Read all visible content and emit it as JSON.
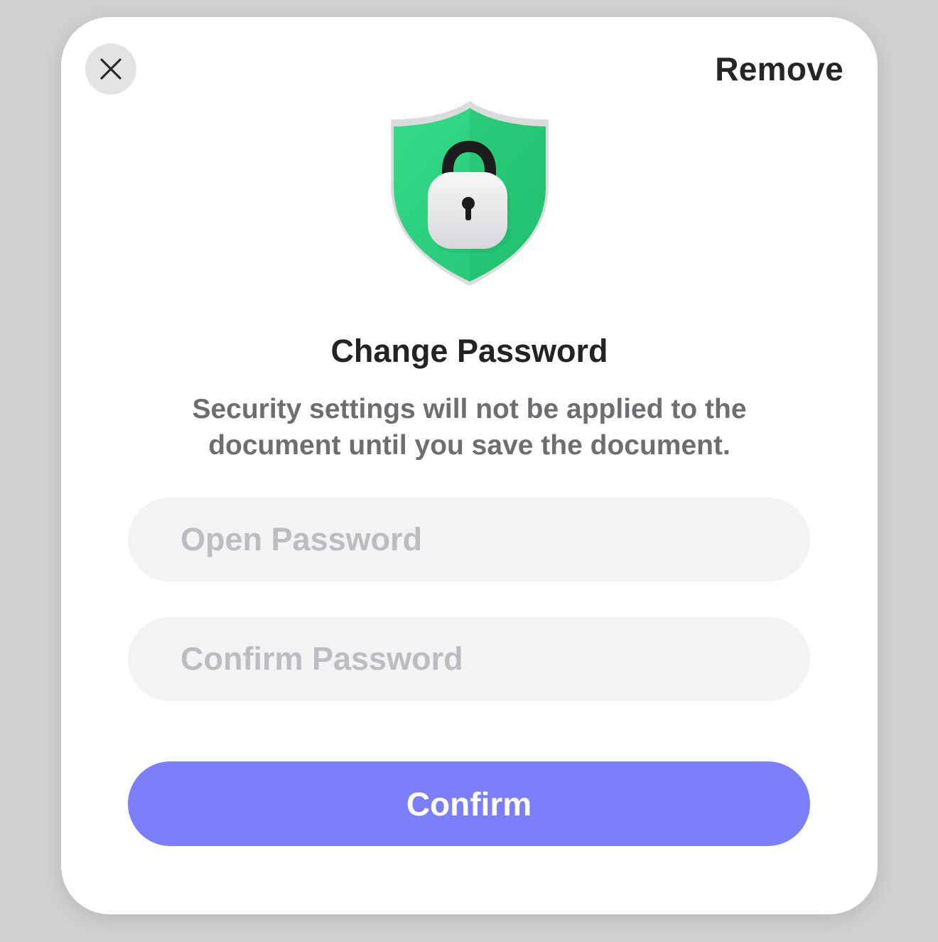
{
  "dialog": {
    "remove_label": "Remove",
    "title": "Change Password",
    "description": "Security settings will not be applied to the document until you save the document.",
    "hero_icon": "shield-lock-icon",
    "close_icon": "close-icon"
  },
  "fields": {
    "open_password": {
      "placeholder": "Open Password",
      "value": ""
    },
    "confirm_password": {
      "placeholder": "Confirm Password",
      "value": ""
    }
  },
  "actions": {
    "confirm_label": "Confirm"
  },
  "colors": {
    "accent": "#7b7ffc",
    "shield_green": "#2cd47f",
    "backdrop": "#d1d1d3"
  }
}
